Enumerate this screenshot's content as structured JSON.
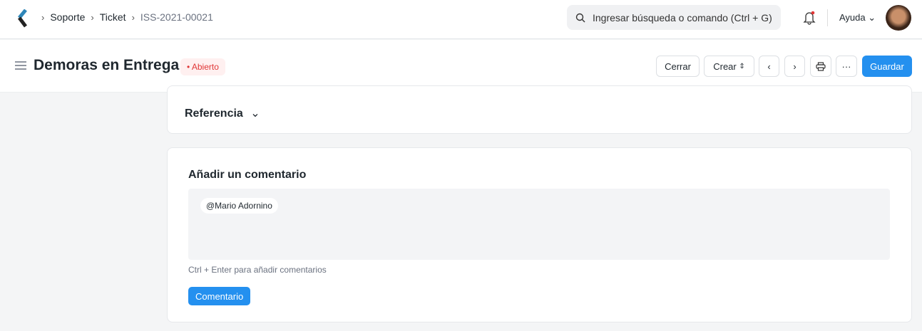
{
  "breadcrumb": [
    "Soporte",
    "Ticket",
    "ISS-2021-00021"
  ],
  "search": {
    "placeholder": "Ingresar búsqueda o comando (Ctrl + G)"
  },
  "help": "Ayuda",
  "doc": {
    "title": "Demoras en Entrega",
    "status": "Abierto"
  },
  "actions": {
    "close": "Cerrar",
    "create": "Crear",
    "more": "···",
    "save": "Guardar"
  },
  "section": {
    "label": "Referencia"
  },
  "comment": {
    "heading": "Añadir un comentario",
    "mention": "@Mario Adornino",
    "hint": "Ctrl + Enter para añadir comentarios",
    "button": "Comentario"
  },
  "colors": {
    "primary": "#2490ef",
    "status": "#e03636"
  }
}
